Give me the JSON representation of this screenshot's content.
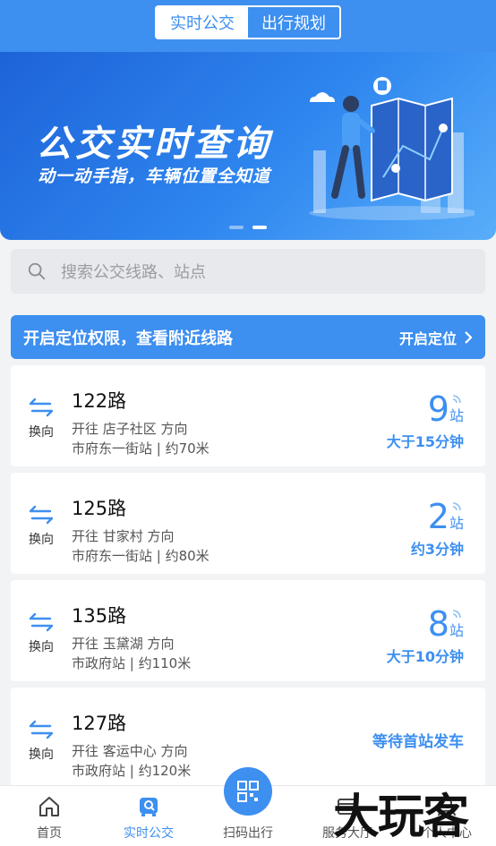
{
  "header": {
    "tabs": [
      {
        "label": "实时公交",
        "active": true
      },
      {
        "label": "出行规划",
        "active": false
      }
    ]
  },
  "banner": {
    "title": "公交实时查询",
    "subtitle": "动一动手指，车辆位置全知道",
    "page_indicator": {
      "count": 2,
      "current": 2
    }
  },
  "search": {
    "placeholder": "搜索公交线路、站点",
    "icon": "search-icon"
  },
  "location_bar": {
    "text": "开启定位权限，查看附近线路",
    "button": "开启定位"
  },
  "routes": [
    {
      "swap_label": "换向",
      "name": "122路",
      "direction": "开往 店子社区 方向",
      "stop": "市府东一街站 | 约70米",
      "stations": "9",
      "station_unit": "站",
      "eta": "大于15分钟"
    },
    {
      "swap_label": "换向",
      "name": "125路",
      "direction": "开往 甘家村 方向",
      "stop": "市府东一街站 | 约80米",
      "stations": "2",
      "station_unit": "站",
      "eta": "约3分钟"
    },
    {
      "swap_label": "换向",
      "name": "135路",
      "direction": "开往 玉黛湖 方向",
      "stop": "市政府站 | 约110米",
      "stations": "8",
      "station_unit": "站",
      "eta": "大于10分钟"
    },
    {
      "swap_label": "换向",
      "name": "127路",
      "direction": "开往 客运中心 方向",
      "stop": "市政府站 | 约120米",
      "status": "等待首站发车"
    }
  ],
  "tabbar": {
    "items": [
      {
        "label": "首页",
        "icon": "home-icon"
      },
      {
        "label": "实时公交",
        "icon": "bus-icon",
        "active": true
      },
      {
        "label": "扫码出行",
        "icon": "qr-icon"
      },
      {
        "label": "服务大厅",
        "icon": "service-icon"
      },
      {
        "label": "个人中心",
        "icon": "user-icon"
      }
    ]
  },
  "watermark": "大玩客",
  "colors": {
    "accent": "#3d8ff0"
  }
}
